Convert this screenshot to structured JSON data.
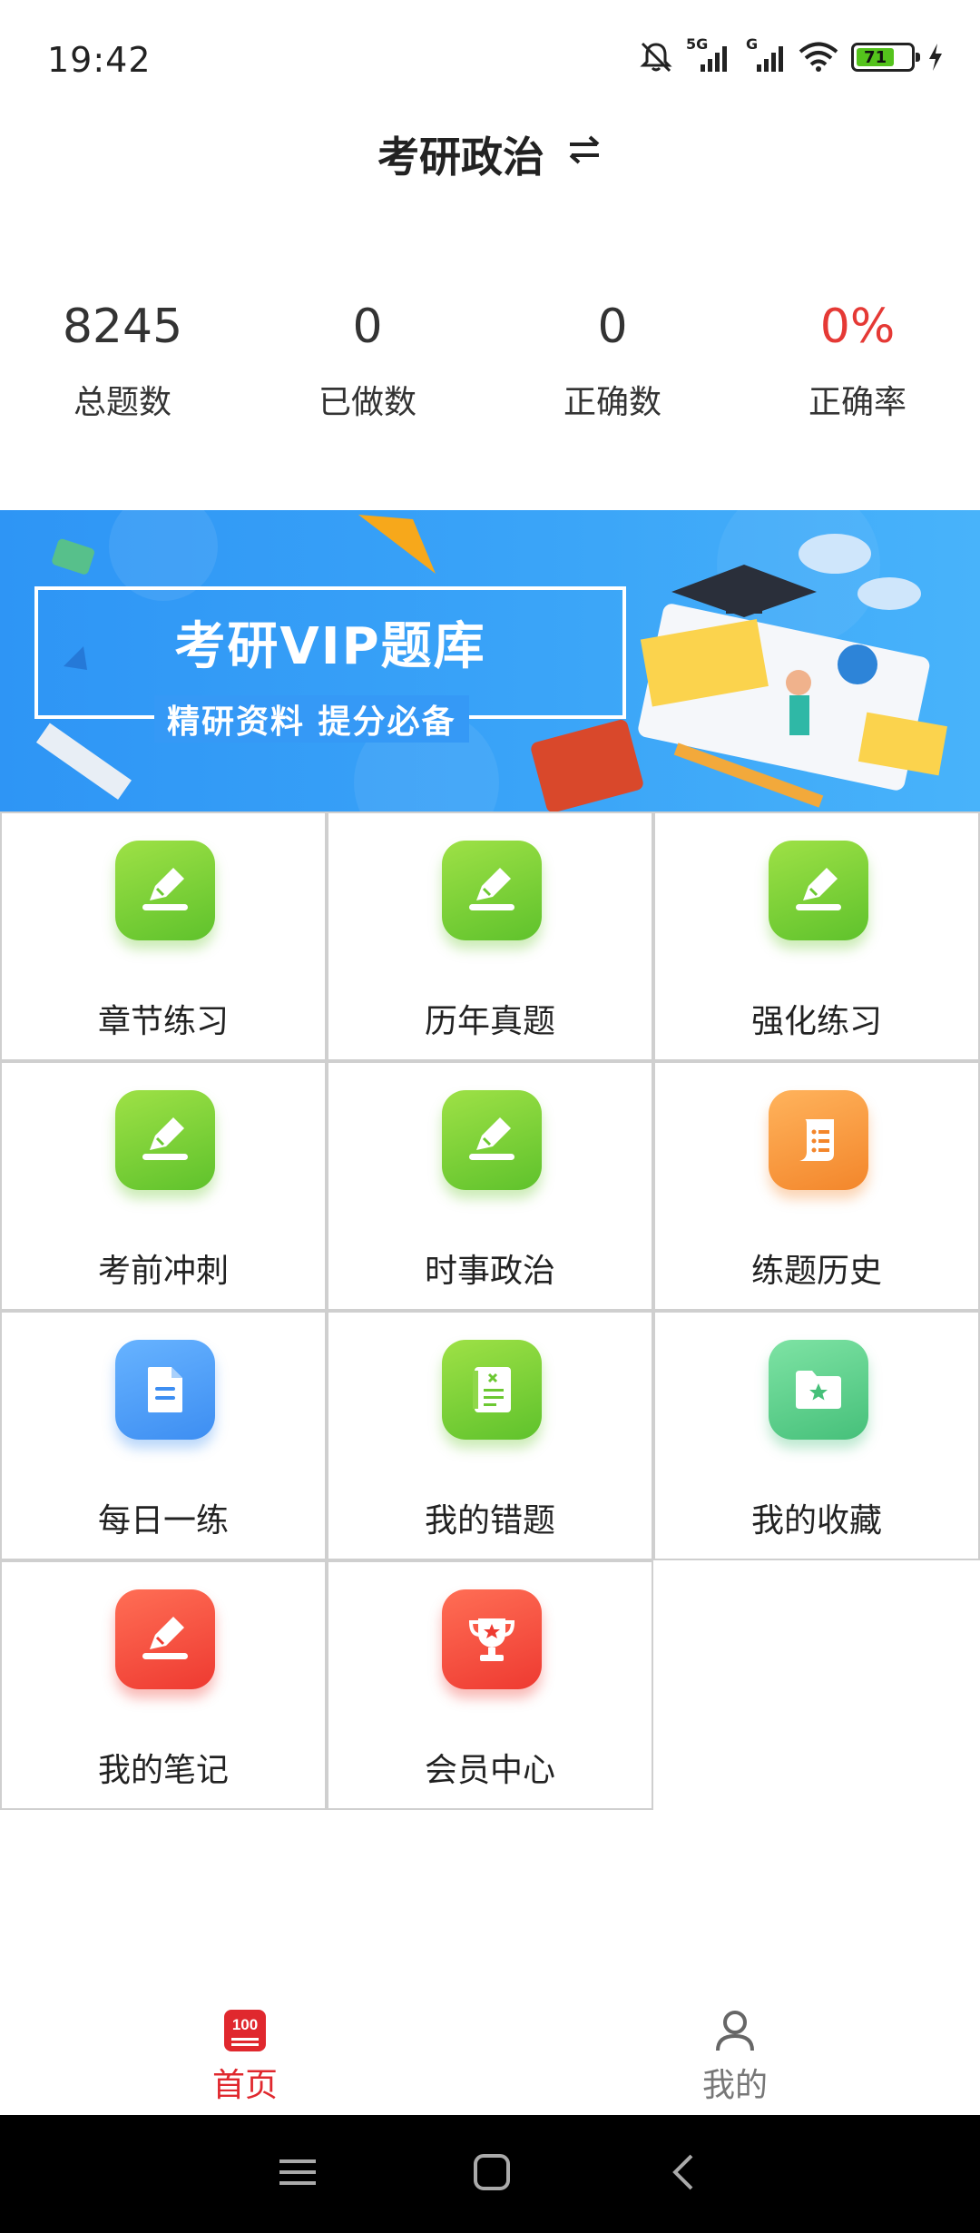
{
  "status_bar": {
    "time": "19:42",
    "battery_level": "71",
    "signal_1_label": "5G",
    "signal_2_label": "G"
  },
  "header": {
    "title": "考研政治",
    "switch_icon": "swap-arrows-icon"
  },
  "stats": [
    {
      "value": "8245",
      "label": "总题数"
    },
    {
      "value": "0",
      "label": "已做数"
    },
    {
      "value": "0",
      "label": "正确数"
    },
    {
      "value": "0%",
      "label": "正确率"
    }
  ],
  "banner": {
    "title": "考研VIP题库",
    "subtitle": "精研资料  提分必备"
  },
  "menu": [
    {
      "label": "章节练习",
      "icon": "pencil-icon",
      "color": "#6cc832"
    },
    {
      "label": "历年真题",
      "icon": "pencil-icon",
      "color": "#6cc832"
    },
    {
      "label": "强化练习",
      "icon": "pencil-icon",
      "color": "#6cc832"
    },
    {
      "label": "考前冲刺",
      "icon": "pencil-icon",
      "color": "#6cc832"
    },
    {
      "label": "时事政治",
      "icon": "pencil-icon",
      "color": "#6cc832"
    },
    {
      "label": "练题历史",
      "icon": "scroll-icon",
      "color": "#f3862b"
    },
    {
      "label": "每日一练",
      "icon": "document-icon",
      "color": "#3d8ef2"
    },
    {
      "label": "我的错题",
      "icon": "notebook-icon",
      "color": "#6cc832"
    },
    {
      "label": "我的收藏",
      "icon": "star-folder-icon",
      "color": "#46c07a"
    },
    {
      "label": "我的笔记",
      "icon": "pencil-icon",
      "color": "#ee3a31"
    },
    {
      "label": "会员中心",
      "icon": "trophy-icon",
      "color": "#ee3a31"
    }
  ],
  "tabs": [
    {
      "label": "首页",
      "icon": "home-100-icon",
      "badge_text": "100",
      "active": true
    },
    {
      "label": "我的",
      "icon": "person-icon",
      "active": false
    }
  ],
  "colors": {
    "accent": "#e0282e",
    "rate_red": "#e53935",
    "banner_blue": "#2e95f5"
  }
}
